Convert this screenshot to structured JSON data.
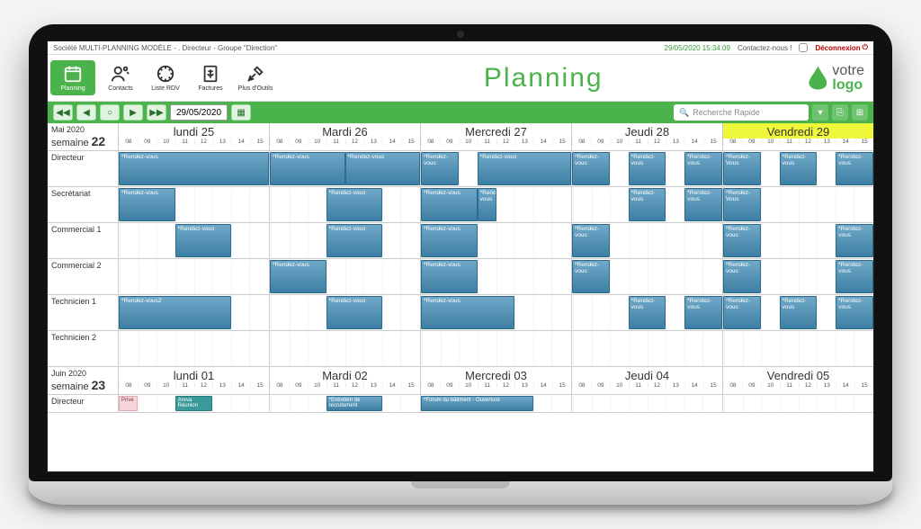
{
  "topline": {
    "left": "Société MULTI-PLANNING MODÈLE - . Directeur - Groupe \"Direction\"",
    "stamp": "29/05/2020 15:34:09",
    "contact": "Contactez-nous !",
    "logout": "Déconnexion"
  },
  "nav": {
    "items": [
      {
        "key": "planning",
        "label": "Planning"
      },
      {
        "key": "contacts",
        "label": "Contacts"
      },
      {
        "key": "listerdv",
        "label": "Liste RDV"
      },
      {
        "key": "factures",
        "label": "Factures"
      },
      {
        "key": "outils",
        "label": "Plus d'Outils"
      }
    ]
  },
  "title": "Planning",
  "brand": {
    "line1": "votre",
    "line2": "logo"
  },
  "ribbon": {
    "date": "29/05/2020",
    "search_placeholder": "Recherche Rapide"
  },
  "hours": [
    "08",
    "09",
    "10",
    "11",
    "12",
    "13",
    "14",
    "15"
  ],
  "weeks": [
    {
      "month": "Mai 2020",
      "weeknum": "22",
      "days": [
        {
          "label": "lundi 25",
          "highlight": false
        },
        {
          "label": "Mardi 26",
          "highlight": false
        },
        {
          "label": "Mercredi 27",
          "highlight": false
        },
        {
          "label": "Jeudi 28",
          "highlight": false
        },
        {
          "label": "Vendredi 29",
          "highlight": true
        }
      ],
      "rows": [
        {
          "label": "Directeur",
          "events": [
            {
              "day": 0,
              "start": 0,
              "span": 8,
              "text": "*Rendez-vous"
            },
            {
              "day": 1,
              "start": 0,
              "span": 4,
              "text": "*Rendez-vous"
            },
            {
              "day": 1,
              "start": 4,
              "span": 4,
              "text": "*Rendez-vous"
            },
            {
              "day": 2,
              "start": 0,
              "span": 2,
              "text": "*Rendez-vous"
            },
            {
              "day": 2,
              "start": 3,
              "span": 5,
              "text": "*Rendez-vous"
            },
            {
              "day": 3,
              "start": 0,
              "span": 2,
              "text": "*Rendez-vous"
            },
            {
              "day": 3,
              "start": 3,
              "span": 2,
              "text": "*Rendez-vous"
            },
            {
              "day": 3,
              "start": 6,
              "span": 2,
              "text": "*Rendez-vous"
            },
            {
              "day": 4,
              "start": 0,
              "span": 2,
              "text": "*Rendez-Vous"
            },
            {
              "day": 4,
              "start": 3,
              "span": 2,
              "text": "*Rendez-vous"
            },
            {
              "day": 4,
              "start": 6,
              "span": 2,
              "text": "*Rendez-vous"
            }
          ]
        },
        {
          "label": "Secrétariat",
          "events": [
            {
              "day": 0,
              "start": 0,
              "span": 3,
              "text": "*Rendez-vous"
            },
            {
              "day": 1,
              "start": 3,
              "span": 3,
              "text": "*Rendez-vous"
            },
            {
              "day": 2,
              "start": 0,
              "span": 3,
              "text": "*Rendez-vous"
            },
            {
              "day": 2,
              "start": 3,
              "span": 1,
              "text": "*Rendez-vous"
            },
            {
              "day": 3,
              "start": 3,
              "span": 2,
              "text": "*Rendez-vous"
            },
            {
              "day": 3,
              "start": 6,
              "span": 2,
              "text": "*Rendez-vous"
            },
            {
              "day": 4,
              "start": 0,
              "span": 2,
              "text": "*Rendez-Vous"
            }
          ]
        },
        {
          "label": "Commercial 1",
          "events": [
            {
              "day": 0,
              "start": 3,
              "span": 3,
              "text": "*Rendez-vous"
            },
            {
              "day": 1,
              "start": 3,
              "span": 3,
              "text": "*Rendez-vous"
            },
            {
              "day": 2,
              "start": 0,
              "span": 3,
              "text": "*Rendez-vous"
            },
            {
              "day": 3,
              "start": 0,
              "span": 2,
              "text": "*Rendez-vous"
            },
            {
              "day": 4,
              "start": 0,
              "span": 2,
              "text": "*Rendez-vous"
            },
            {
              "day": 4,
              "start": 6,
              "span": 2,
              "text": "*Rendez-vous"
            }
          ]
        },
        {
          "label": "Commercial 2",
          "events": [
            {
              "day": 1,
              "start": 0,
              "span": 3,
              "text": "*Rendez-vous"
            },
            {
              "day": 2,
              "start": 0,
              "span": 3,
              "text": "*Rendez-vous"
            },
            {
              "day": 3,
              "start": 0,
              "span": 2,
              "text": "*Rendez-vous"
            },
            {
              "day": 4,
              "start": 0,
              "span": 2,
              "text": "*Rendez-vous"
            },
            {
              "day": 4,
              "start": 6,
              "span": 2,
              "text": "*Rendez-vous"
            }
          ]
        },
        {
          "label": "Technicien 1",
          "events": [
            {
              "day": 0,
              "start": 0,
              "span": 6,
              "text": "*Rendez-vous2"
            },
            {
              "day": 1,
              "start": 3,
              "span": 3,
              "text": "*Rendez-vous"
            },
            {
              "day": 2,
              "start": 0,
              "span": 5,
              "text": "*Rendez-vous"
            },
            {
              "day": 3,
              "start": 3,
              "span": 2,
              "text": "*Rendez-vous"
            },
            {
              "day": 3,
              "start": 6,
              "span": 2,
              "text": "*Rendez-vous"
            },
            {
              "day": 4,
              "start": 0,
              "span": 2,
              "text": "*Rendez-vous"
            },
            {
              "day": 4,
              "start": 3,
              "span": 2,
              "text": "*Rendez-vous"
            },
            {
              "day": 4,
              "start": 6,
              "span": 2,
              "text": "*Rendez-vous"
            }
          ]
        },
        {
          "label": "Technicien 2",
          "events": []
        }
      ]
    },
    {
      "month": "Juin 2020",
      "weeknum": "23",
      "days": [
        {
          "label": "lundi 01",
          "highlight": false
        },
        {
          "label": "Mardi 02",
          "highlight": false
        },
        {
          "label": "Mercredi 03",
          "highlight": false
        },
        {
          "label": "Jeudi 04",
          "highlight": false
        },
        {
          "label": "Vendredi 05",
          "highlight": false
        }
      ],
      "rows": [
        {
          "label": "Directeur",
          "short": true,
          "events": [
            {
              "day": 0,
              "start": 0,
              "span": 1,
              "text": "Privé",
              "cls": "pink"
            },
            {
              "day": 0,
              "start": 3,
              "span": 2,
              "text": "Areva Réunion",
              "cls": "teal"
            },
            {
              "day": 1,
              "start": 3,
              "span": 3,
              "text": "*Entretien de recrutement"
            },
            {
              "day": 2,
              "start": 0,
              "span": 6,
              "text": "*Forum du bâtiment - Ouverture"
            }
          ]
        }
      ]
    }
  ],
  "weeklabel": "semaine"
}
